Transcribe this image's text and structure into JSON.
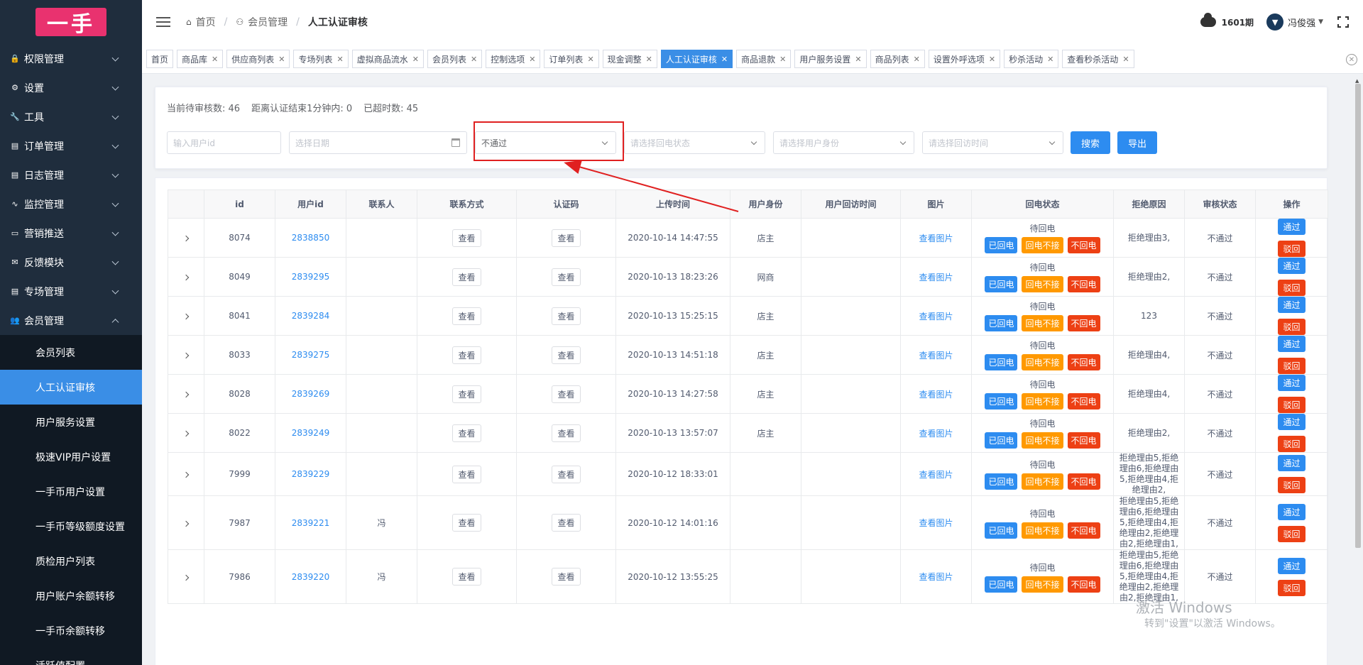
{
  "logo_text": "一手",
  "sidebar": {
    "menus": [
      {
        "label": "权限管理",
        "icon": "lock-icon",
        "glyph": "🔒"
      },
      {
        "label": "设置",
        "icon": "gear-icon",
        "glyph": "⚙"
      },
      {
        "label": "工具",
        "icon": "wrench-icon",
        "glyph": "🔧"
      },
      {
        "label": "订单管理",
        "icon": "list-icon",
        "glyph": "▤"
      },
      {
        "label": "日志管理",
        "icon": "document-icon",
        "glyph": "▤"
      },
      {
        "label": "监控管理",
        "icon": "pulse-icon",
        "glyph": "∿"
      },
      {
        "label": "营销推送",
        "icon": "card-icon",
        "glyph": "▭"
      },
      {
        "label": "反馈模块",
        "icon": "mail-icon",
        "glyph": "✉"
      },
      {
        "label": "专场管理",
        "icon": "list-icon",
        "glyph": "▤"
      },
      {
        "label": "会员管理",
        "icon": "users-icon",
        "glyph": "👥"
      }
    ],
    "sub_items": [
      "会员列表",
      "人工认证审核",
      "用户服务设置",
      "极速VIP用户设置",
      "一手币用户设置",
      "一手币等级额度设置",
      "质检用户列表",
      "用户账户余额转移",
      "一手币余额转移",
      "活跃值配置"
    ]
  },
  "header": {
    "breadcrumb": [
      "首页",
      "会员管理",
      "人工认证审核"
    ],
    "period": "1601期",
    "user": "冯俊强"
  },
  "tabs": [
    "首页",
    "商品库",
    "供应商列表",
    "专场列表",
    "虚拟商品流水",
    "会员列表",
    "控制选项",
    "订单列表",
    "现金调整",
    "人工认证审核",
    "商品退款",
    "用户服务设置",
    "商品列表",
    "设置外呼选项",
    "秒杀活动",
    "查看秒杀活动"
  ],
  "stats": {
    "pending": "当前待审核数: 46",
    "near_end": "距离认证结束1分钟内: 0",
    "overdue": "已超时数: 45"
  },
  "filters": {
    "user_id_placeholder": "输入用户id",
    "date_placeholder": "选择日期",
    "audit_status_value": "不通过",
    "callback_placeholder": "请选择回电状态",
    "identity_placeholder": "请选择用户身份",
    "visit_time_placeholder": "请选择回访时间",
    "search_label": "搜索",
    "export_label": "导出"
  },
  "table": {
    "columns": [
      "",
      "id",
      "用户id",
      "联系人",
      "联系方式",
      "认证码",
      "上传时间",
      "用户身份",
      "用户回访时间",
      "图片",
      "回电状态",
      "拒绝原因",
      "审核状态",
      "操作"
    ],
    "view_label": "查看",
    "view_image_label": "查看图片",
    "callback_state": "待回电",
    "btn_called": "已回电",
    "btn_no_answer": "回电不接",
    "btn_not_called": "不回电",
    "btn_pass": "通过",
    "btn_reject": "驳回",
    "rows": [
      {
        "id": "8074",
        "uid": "2838850",
        "contact": "",
        "time": "2020-10-14 14:47:55",
        "identity": "店主",
        "reason": "拒绝理由3,",
        "status": "不通过"
      },
      {
        "id": "8049",
        "uid": "2839295",
        "contact": "",
        "time": "2020-10-13 18:23:26",
        "identity": "网商",
        "reason": "拒绝理由2,",
        "status": "不通过"
      },
      {
        "id": "8041",
        "uid": "2839284",
        "contact": "",
        "time": "2020-10-13 15:25:15",
        "identity": "店主",
        "reason": "123",
        "status": "不通过"
      },
      {
        "id": "8033",
        "uid": "2839275",
        "contact": "",
        "time": "2020-10-13 14:51:18",
        "identity": "店主",
        "reason": "拒绝理由4,",
        "status": "不通过"
      },
      {
        "id": "8028",
        "uid": "2839269",
        "contact": "",
        "time": "2020-10-13 14:27:58",
        "identity": "店主",
        "reason": "拒绝理由4,",
        "status": "不通过"
      },
      {
        "id": "8022",
        "uid": "2839249",
        "contact": "",
        "time": "2020-10-13 13:57:07",
        "identity": "店主",
        "reason": "拒绝理由2,",
        "status": "不通过"
      },
      {
        "id": "7999",
        "uid": "2839229",
        "contact": "",
        "time": "2020-10-12 18:33:01",
        "identity": "",
        "reason": "拒绝理由5,拒绝理由6,拒绝理由5,拒绝理由4,拒绝理由2,",
        "status": "不通过"
      },
      {
        "id": "7987",
        "uid": "2839221",
        "contact": "冯",
        "time": "2020-10-12 14:01:16",
        "identity": "",
        "reason": "拒绝理由5,拒绝理由6,拒绝理由5,拒绝理由4,拒绝理由2,拒绝理由2,拒绝理由1,",
        "status": "不通过"
      },
      {
        "id": "7986",
        "uid": "2839220",
        "contact": "冯",
        "time": "2020-10-12 13:55:25",
        "identity": "",
        "reason": "拒绝理由5,拒绝理由6,拒绝理由5,拒绝理由4,拒绝理由2,拒绝理由2,拒绝理由1,",
        "status": "不通过"
      }
    ]
  },
  "watermark": {
    "line1": "激活 Windows",
    "line2": "转到\"设置\"以激活 Windows。"
  }
}
